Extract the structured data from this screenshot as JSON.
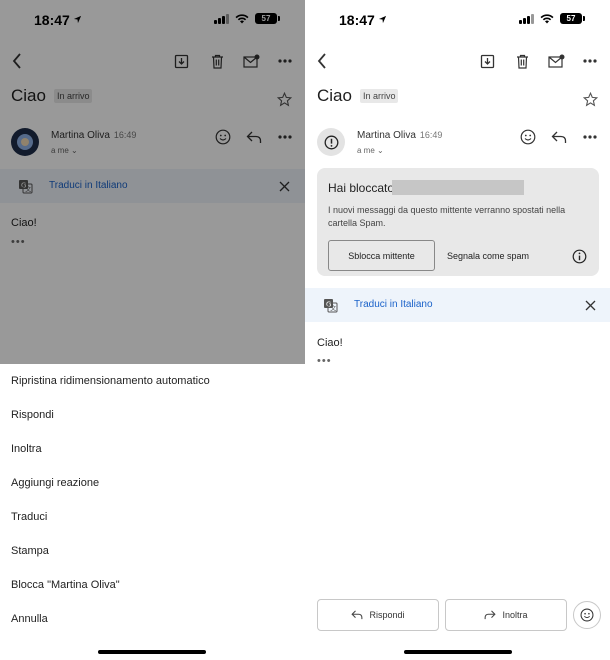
{
  "status_bar": {
    "time": "18:47",
    "battery": "57"
  },
  "email": {
    "subject": "Ciao",
    "folder_badge": "In arrivo",
    "sender": "Martina Oliva",
    "time": "16:49",
    "to": "a me",
    "body": "Ciao!",
    "more": "•••",
    "translate_label": "Traduci in Italiano"
  },
  "context_menu": {
    "items": [
      "Ripristina ridimensionamento automatico",
      "Rispondi",
      "Inoltra",
      "Aggiungi reazione",
      "Traduci",
      "Stampa",
      "Blocca \"Martina Oliva\"",
      "Annulla"
    ]
  },
  "blocked_card": {
    "title": "Hai bloccato",
    "description": "I nuovi messaggi da questo mittente verranno spostati nella cartella Spam.",
    "unblock_label": "Sblocca mittente",
    "report_spam_label": "Segnala come spam"
  },
  "actions": {
    "reply_label": "Rispondi",
    "forward_label": "Inoltra"
  },
  "icons": {
    "back": "back-chevron-icon",
    "archive": "archive-icon",
    "delete": "trash-icon",
    "mark_unread": "mail-unread-icon",
    "more": "more-horizontal-icon",
    "star": "star-icon",
    "emoji": "emoji-icon",
    "reply": "reply-icon",
    "close": "close-icon",
    "translate": "translate-icon",
    "info": "info-icon",
    "warning": "exclamation-icon"
  },
  "colors": {
    "link_blue": "#1a62c9",
    "overlay": "#000000",
    "card_gray": "#e8e8e8"
  }
}
